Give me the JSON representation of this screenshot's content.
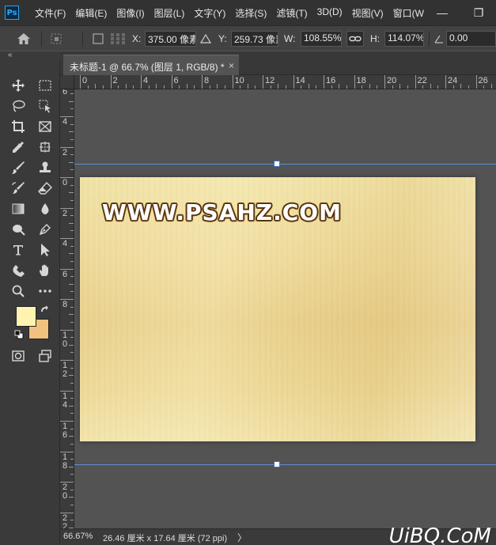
{
  "app": {
    "logo": "Ps"
  },
  "menu": [
    "文件(F)",
    "编辑(E)",
    "图像(I)",
    "图层(L)",
    "文字(Y)",
    "选择(S)",
    "滤镜(T)",
    "3D(D)",
    "视图(V)",
    "窗口(W"
  ],
  "window_controls": {
    "minimize": "—",
    "restore": "❐"
  },
  "options": {
    "x_label": "X:",
    "x_value": "375.00 像素",
    "y_label": "Y:",
    "y_value": "259.73 像素",
    "w_label": "W:",
    "w_value": "108.55%",
    "h_label": "H:",
    "h_value": "114.07%",
    "angle_value": "0.00"
  },
  "tab": {
    "title": "未标题-1 @ 66.7% (图层 1, RGB/8) *",
    "close": "×"
  },
  "ruler_top": [
    "0",
    "2",
    "4",
    "6",
    "8",
    "10",
    "12",
    "14",
    "16",
    "18",
    "20",
    "22",
    "24",
    "26"
  ],
  "ruler_left": [
    "6",
    "4",
    "2",
    "0",
    "2",
    "4",
    "6",
    "8",
    "1\n0",
    "1\n2",
    "1\n4",
    "1\n6",
    "1\n8",
    "2\n0",
    "2\n2"
  ],
  "canvas": {
    "text": "WWW.PSAHZ.COM"
  },
  "colors": {
    "foreground": "#fff3b0",
    "background": "#f0c27e",
    "guide": "#5a8fd8"
  },
  "status": {
    "zoom": "66.67%",
    "doc_size": "26.46 厘米 x 17.64 厘米 (72 ppi)",
    "arrow": "〉"
  },
  "watermark": "UiBQ.CoM",
  "icons": [
    "move-icon",
    "marquee-icon",
    "lasso-icon",
    "quick-select-icon",
    "crop-icon",
    "frame-icon",
    "eyedropper-icon",
    "healing-icon",
    "brush-icon",
    "stamp-icon",
    "history-brush-icon",
    "eraser-icon",
    "gradient-icon",
    "blur-icon",
    "dodge-icon",
    "pen-icon",
    "type-icon",
    "path-select-icon",
    "shape-icon",
    "hand-icon",
    "zoom-icon",
    "more-icon"
  ]
}
